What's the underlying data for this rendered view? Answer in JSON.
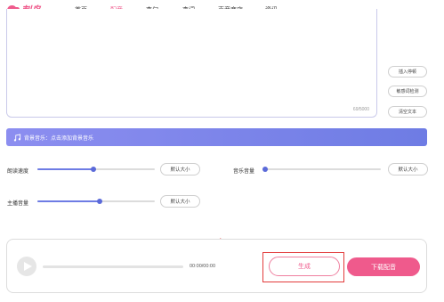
{
  "app": {
    "logo_text": "刺鸟",
    "logo_sub": "C I N I A O",
    "brand_color": "#ef5a8c",
    "accent_color": "#6e7ce4"
  },
  "nav": {
    "items": [
      {
        "label": "首页",
        "active": false
      },
      {
        "label": "配音",
        "active": true
      },
      {
        "label": "查句",
        "active": false
      },
      {
        "label": "查词",
        "active": false
      },
      {
        "label": "声音商店",
        "active": false
      },
      {
        "label": "资讯",
        "active": false
      }
    ]
  },
  "editor": {
    "char_count": "69/5000"
  },
  "side_buttons": {
    "insert_pause": "插入停顿",
    "sensitive_check": "敏感词检测",
    "clear_text": "清空文本"
  },
  "bgm": {
    "icon": "music-note-icon",
    "text": "背景音乐：点击添加背景音乐"
  },
  "sliders": {
    "reading_speed": {
      "label": "朗读速度",
      "value": 0.48,
      "default_label": "默认大小"
    },
    "music_volume": {
      "label": "音乐音量",
      "value": 0.0,
      "default_label": "默认大小"
    },
    "anchor_volume": {
      "label": "主播音量",
      "value": 0.53,
      "default_label": "默认大小"
    }
  },
  "player": {
    "play_icon": "play-icon",
    "progress": 0,
    "time": "00:00/00:00",
    "generate_label": "生成",
    "download_label": "下载配音"
  },
  "annotation": {
    "color": "#e23b3b"
  }
}
